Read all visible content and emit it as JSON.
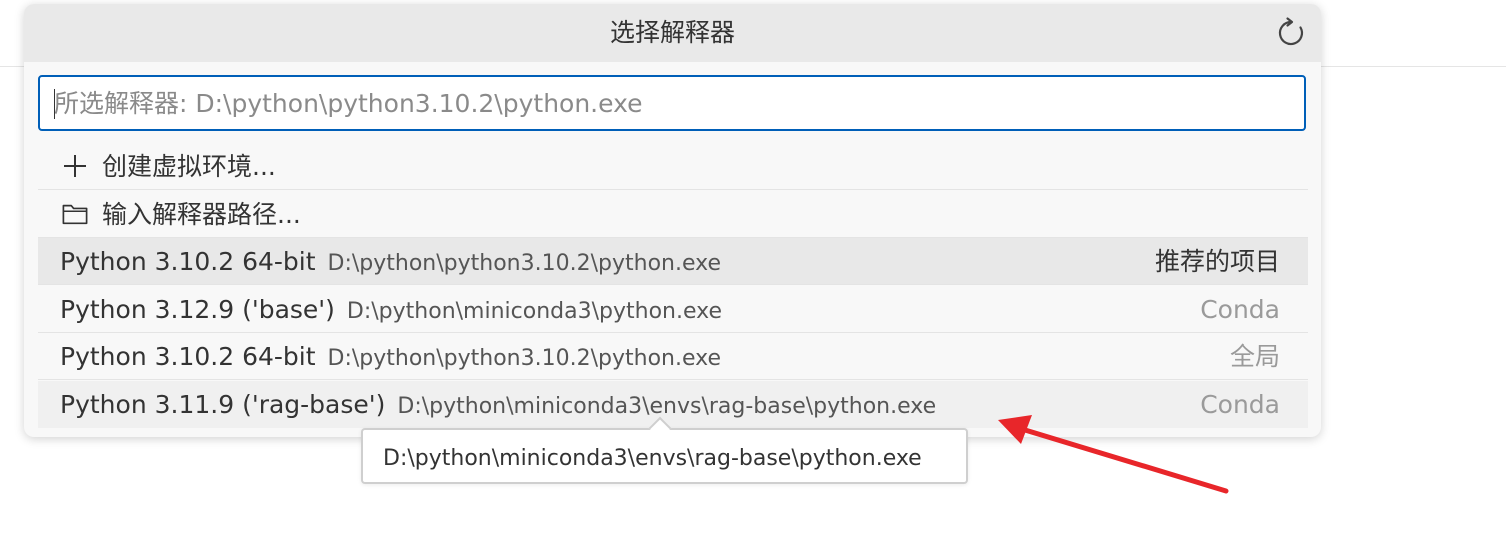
{
  "quick_pick": {
    "title": "选择解释器",
    "refresh_icon": "refresh-icon",
    "input": {
      "placeholder": "所选解释器: D:\\python\\python3.10.2\\python.exe",
      "value": ""
    },
    "actions": [
      {
        "icon": "plus-icon",
        "label": "创建虚拟环境..."
      },
      {
        "icon": "folder-icon",
        "label": "输入解释器路径..."
      }
    ],
    "interpreters": [
      {
        "name": "Python 3.10.2 64-bit",
        "path": "D:\\python\\python3.10.2\\python.exe",
        "tag": "推荐的项目"
      },
      {
        "name": "Python 3.12.9 ('base')",
        "path": "D:\\python\\miniconda3\\python.exe",
        "tag": "Conda"
      },
      {
        "name": "Python 3.10.2 64-bit",
        "path": "D:\\python\\python3.10.2\\python.exe",
        "tag": "全局"
      },
      {
        "name": "Python 3.11.9 ('rag-base')",
        "path": "D:\\python\\miniconda3\\envs\\rag-base\\python.exe",
        "tag": "Conda"
      }
    ]
  },
  "tooltip": {
    "text": "D:\\python\\miniconda3\\envs\\rag-base\\python.exe"
  },
  "annotation": {
    "arrow_color": "#e8262a"
  },
  "colors": {
    "focus_border": "#005fb8",
    "title_bar": "#e9e9e9",
    "panel": "#f8f8f8"
  }
}
